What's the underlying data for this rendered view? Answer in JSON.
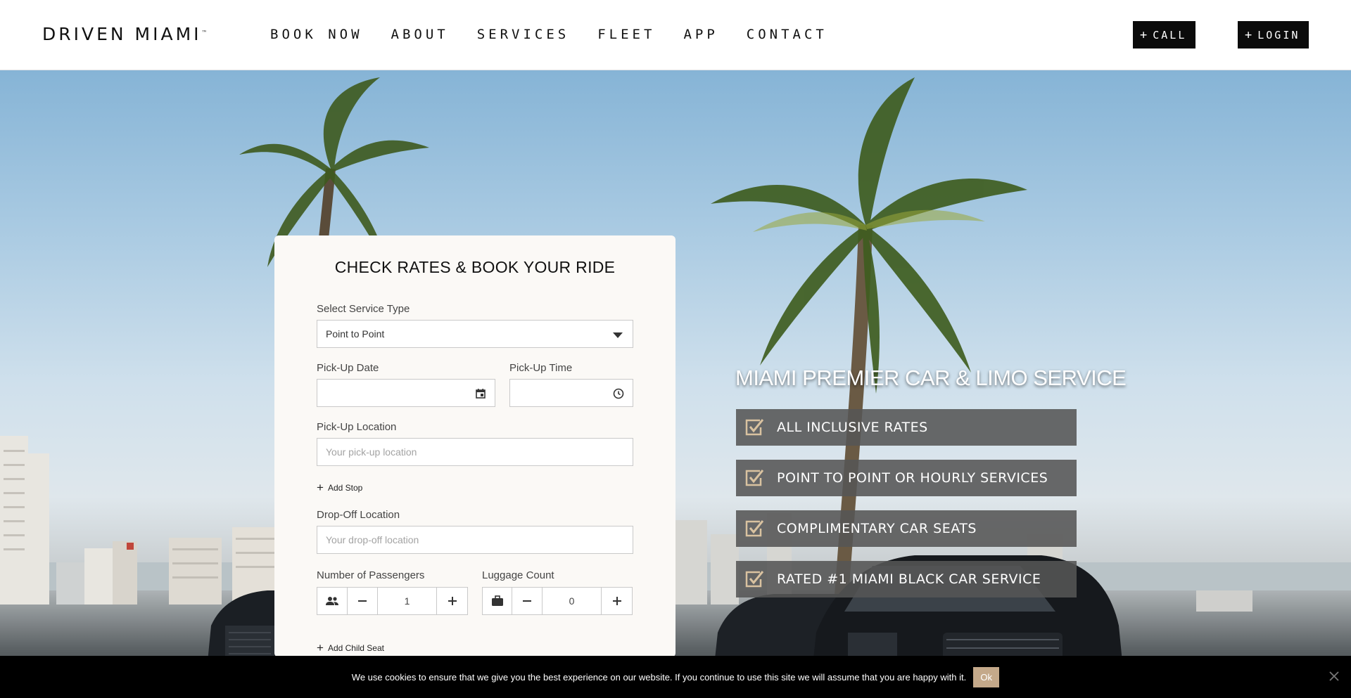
{
  "header": {
    "logo": "DRIVEN MIAMI",
    "logo_tm": "™",
    "nav": [
      "BOOK NOW",
      "ABOUT",
      "SERVICES",
      "FLEET",
      "APP",
      "CONTACT"
    ],
    "call_label": "CALL",
    "login_label": "LOGIN"
  },
  "booking": {
    "title": "CHECK RATES & BOOK YOUR RIDE",
    "service_type_label": "Select Service Type",
    "service_type_value": "Point to Point",
    "pickup_date_label": "Pick-Up Date",
    "pickup_time_label": "Pick-Up Time",
    "pickup_location_label": "Pick-Up Location",
    "pickup_location_placeholder": "Your pick-up location",
    "add_stop_label": "Add Stop",
    "dropoff_location_label": "Drop-Off Location",
    "dropoff_location_placeholder": "Your drop-off location",
    "passengers_label": "Number of Passengers",
    "passengers_value": "1",
    "luggage_label": "Luggage Count",
    "luggage_value": "0",
    "add_child_seat_label": "Add Child Seat"
  },
  "hero": {
    "title": "MIAMI PREMIER CAR & LIMO SERVICE",
    "features": [
      "ALL INCLUSIVE RATES",
      "POINT TO POINT OR HOURLY SERVICES",
      "COMPLIMENTARY CAR SEATS",
      "RATED #1 MIAMI BLACK CAR SERVICE"
    ]
  },
  "cookie": {
    "text": "We use cookies to ensure that we give you the best experience on our website. If you continue to use this site we will assume that you are happy with it.",
    "ok_label": "Ok"
  },
  "colors": {
    "header_bg": "#ffffff",
    "button_bg": "#0b0b0b",
    "card_bg": "#fbf9f6",
    "feature_bg": "#555555",
    "cookie_bg": "#000000",
    "ok_bg": "#c4a98a"
  },
  "icons": {
    "call_button": "plus-icon",
    "login_button": "plus-icon",
    "service_select": "triangle-down-icon",
    "date_field": "calendar-icon",
    "time_field": "clock-icon",
    "passengers": "people-icon",
    "luggage": "briefcase-icon",
    "stepper_minus": "minus-icon",
    "stepper_plus": "plus-icon",
    "features": "checkbox-icon",
    "cookie_close": "close-icon"
  }
}
